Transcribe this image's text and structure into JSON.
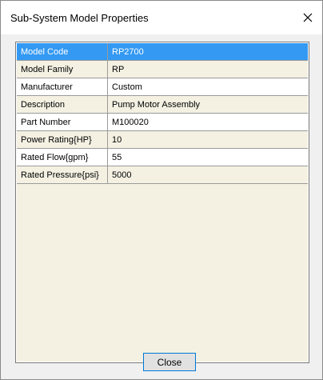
{
  "window": {
    "title": "Sub-System Model Properties"
  },
  "properties": [
    {
      "name": "Model Code",
      "value": "RP2700",
      "style": "selected"
    },
    {
      "name": "Model Family",
      "value": "RP",
      "style": "tan"
    },
    {
      "name": "Manufacturer",
      "value": "Custom",
      "style": "white"
    },
    {
      "name": "Description",
      "value": "Pump Motor Assembly",
      "style": "tan"
    },
    {
      "name": "Part Number",
      "value": "M100020",
      "style": "white"
    },
    {
      "name": "Power Rating{HP}",
      "value": "10",
      "style": "tan"
    },
    {
      "name": "Rated Flow{gpm}",
      "value": "55",
      "style": "white"
    },
    {
      "name": "Rated Pressure{psi}",
      "value": "5000",
      "style": "tan"
    }
  ],
  "footer": {
    "close_label": "Close"
  },
  "colors": {
    "selected": "#3399f3",
    "tan": "#f4f1e3",
    "accent_border": "#0078d7"
  }
}
